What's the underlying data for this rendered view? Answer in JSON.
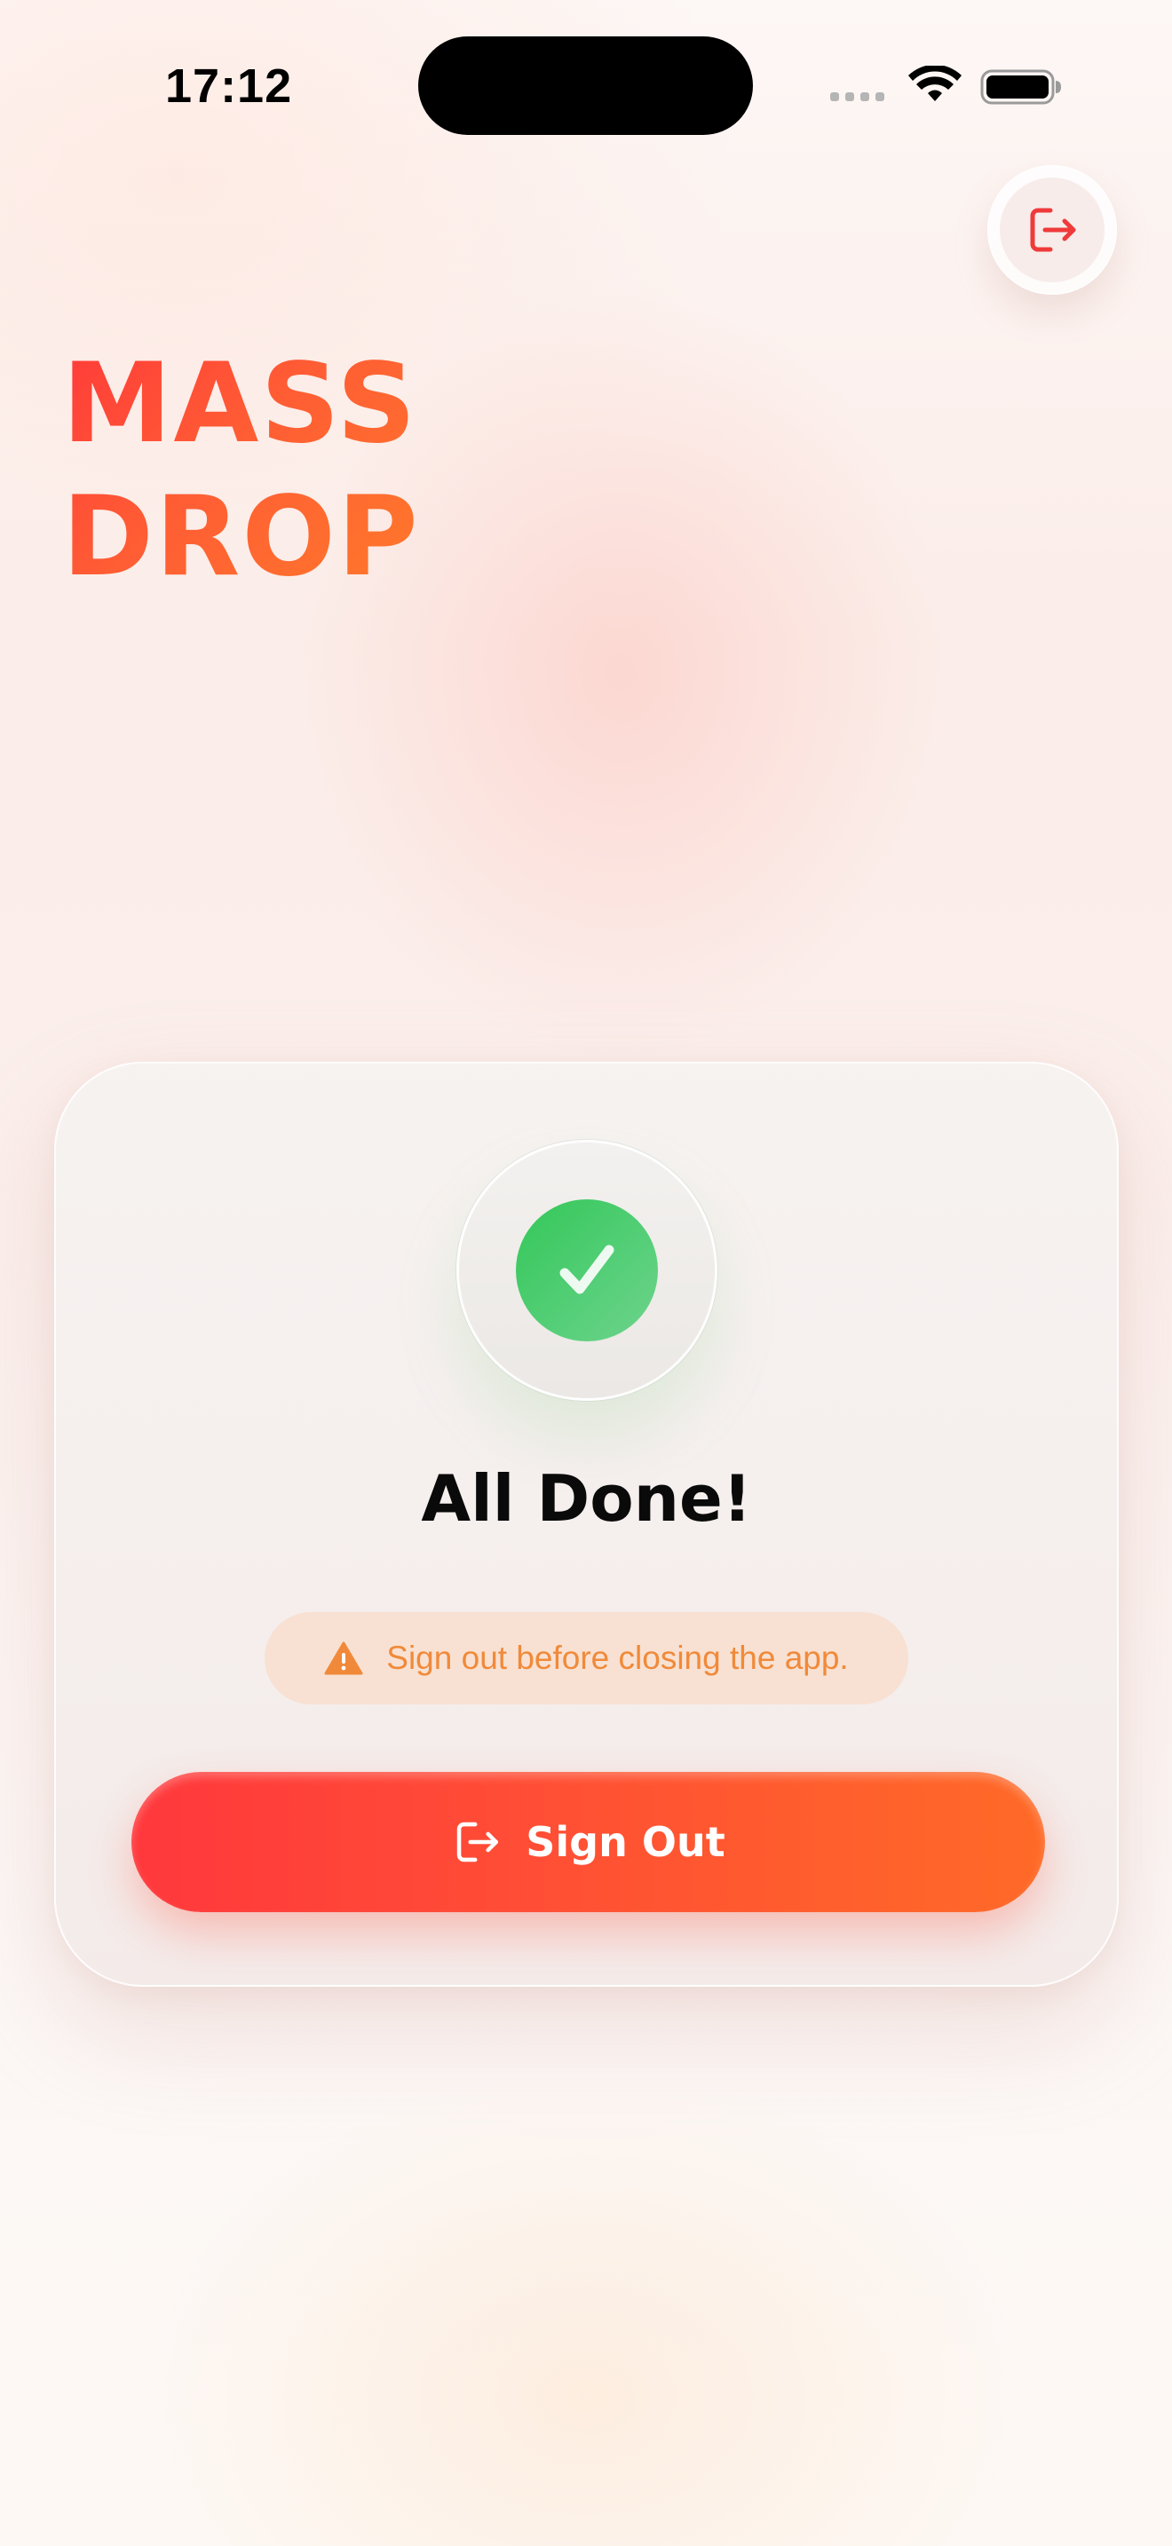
{
  "status_bar": {
    "time": "17:12"
  },
  "top_signout": {
    "icon": "sign-out-icon",
    "color": "#ef3a3a"
  },
  "logo": {
    "line1": "MASS",
    "line2": "DROP"
  },
  "card": {
    "status_icon": "checkmark-icon",
    "title": "All Done!",
    "warning": {
      "icon": "warning-triangle-icon",
      "text": "Sign out before closing the app."
    },
    "signout_button": {
      "icon": "sign-out-icon",
      "label": "Sign Out"
    }
  },
  "colors": {
    "accent_red": "#ff383c",
    "accent_orange": "#ff6a27",
    "success_green": "#34c759",
    "warning_orange": "#f08a3a"
  }
}
